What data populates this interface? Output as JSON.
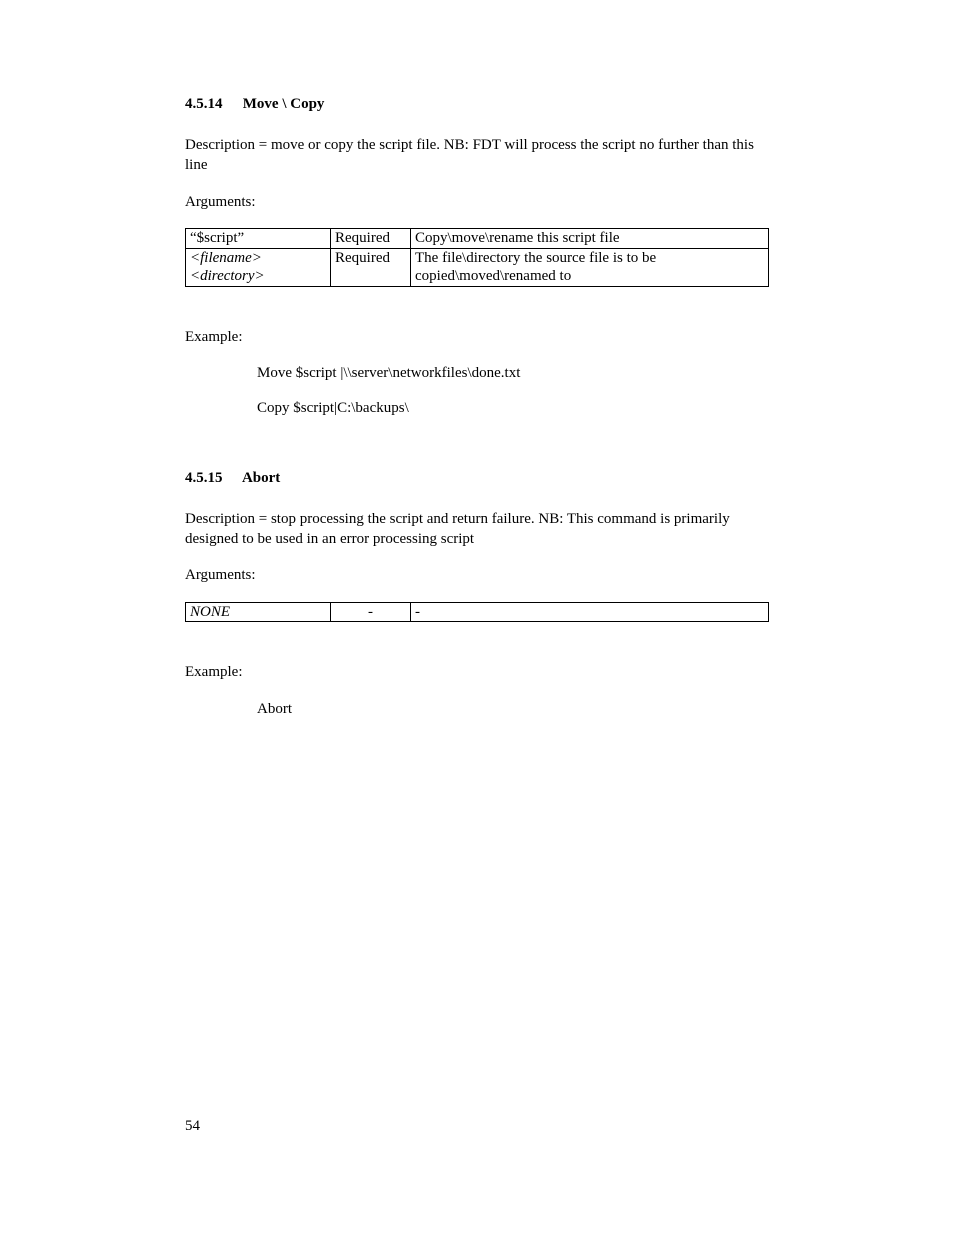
{
  "section1": {
    "number": "4.5.14",
    "title": "Move \\ Copy",
    "description": "Description = move or copy the script file. NB: FDT will process the script no further than this line",
    "arguments_label": "Arguments:",
    "table": {
      "r1c1": "“$script”",
      "r1c2": "Required",
      "r1c3": "Copy\\move\\rename this script file",
      "r2c1a": "<filename>",
      "r2c1b": "<directory>",
      "r2c2": "Required",
      "r2c3": "The file\\directory the source file is to be copied\\moved\\renamed to"
    },
    "example_label": "Example:",
    "example_line1": "Move $script |\\\\server\\networkfiles\\done.txt",
    "example_line2": "Copy $script|C:\\backups\\"
  },
  "section2": {
    "number": "4.5.15",
    "title": "Abort",
    "description": "Description = stop processing the script and return failure. NB: This command is primarily designed to be used in an error processing script",
    "arguments_label": "Arguments:",
    "table": {
      "r1c1": "NONE",
      "r1c2": "-",
      "r1c3": "-"
    },
    "example_label": "Example:",
    "example_line1": "Abort"
  },
  "page_number": "54"
}
